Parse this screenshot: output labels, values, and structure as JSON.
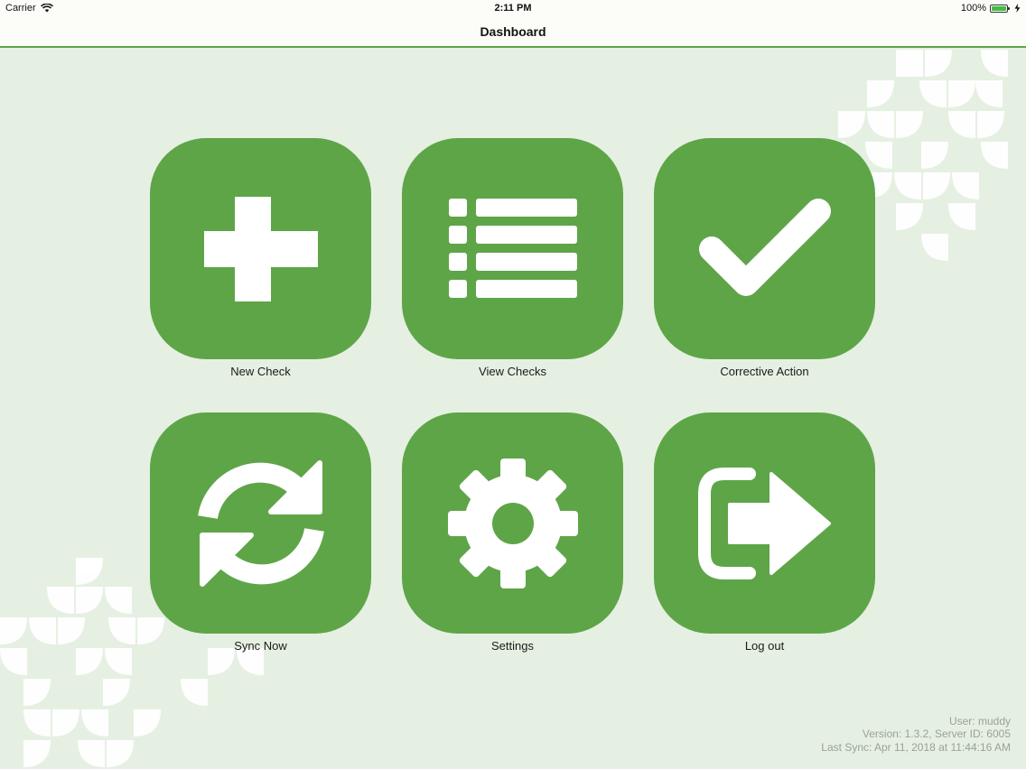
{
  "status_bar": {
    "carrier": "Carrier",
    "time": "2:11 PM",
    "battery": "100%",
    "battery_level": 1.0
  },
  "nav": {
    "title": "Dashboard"
  },
  "tiles": [
    {
      "label": "New Check",
      "icon": "plus-icon"
    },
    {
      "label": "View Checks",
      "icon": "list-icon"
    },
    {
      "label": "Corrective Action",
      "icon": "checkmark-icon"
    },
    {
      "label": "Sync Now",
      "icon": "sync-icon"
    },
    {
      "label": "Settings",
      "icon": "gear-icon"
    },
    {
      "label": "Log out",
      "icon": "logout-icon"
    }
  ],
  "footer": {
    "user": "User: muddy",
    "version": "Version: 1.3.2, Server ID: 6005",
    "last_sync": "Last Sync: Apr 11, 2018 at 11:44:16 AM"
  },
  "colors": {
    "accent": "#5ea548",
    "background": "#e5f0e2",
    "bar": "#fcfcf9",
    "footer_text": "#9aa09a"
  }
}
